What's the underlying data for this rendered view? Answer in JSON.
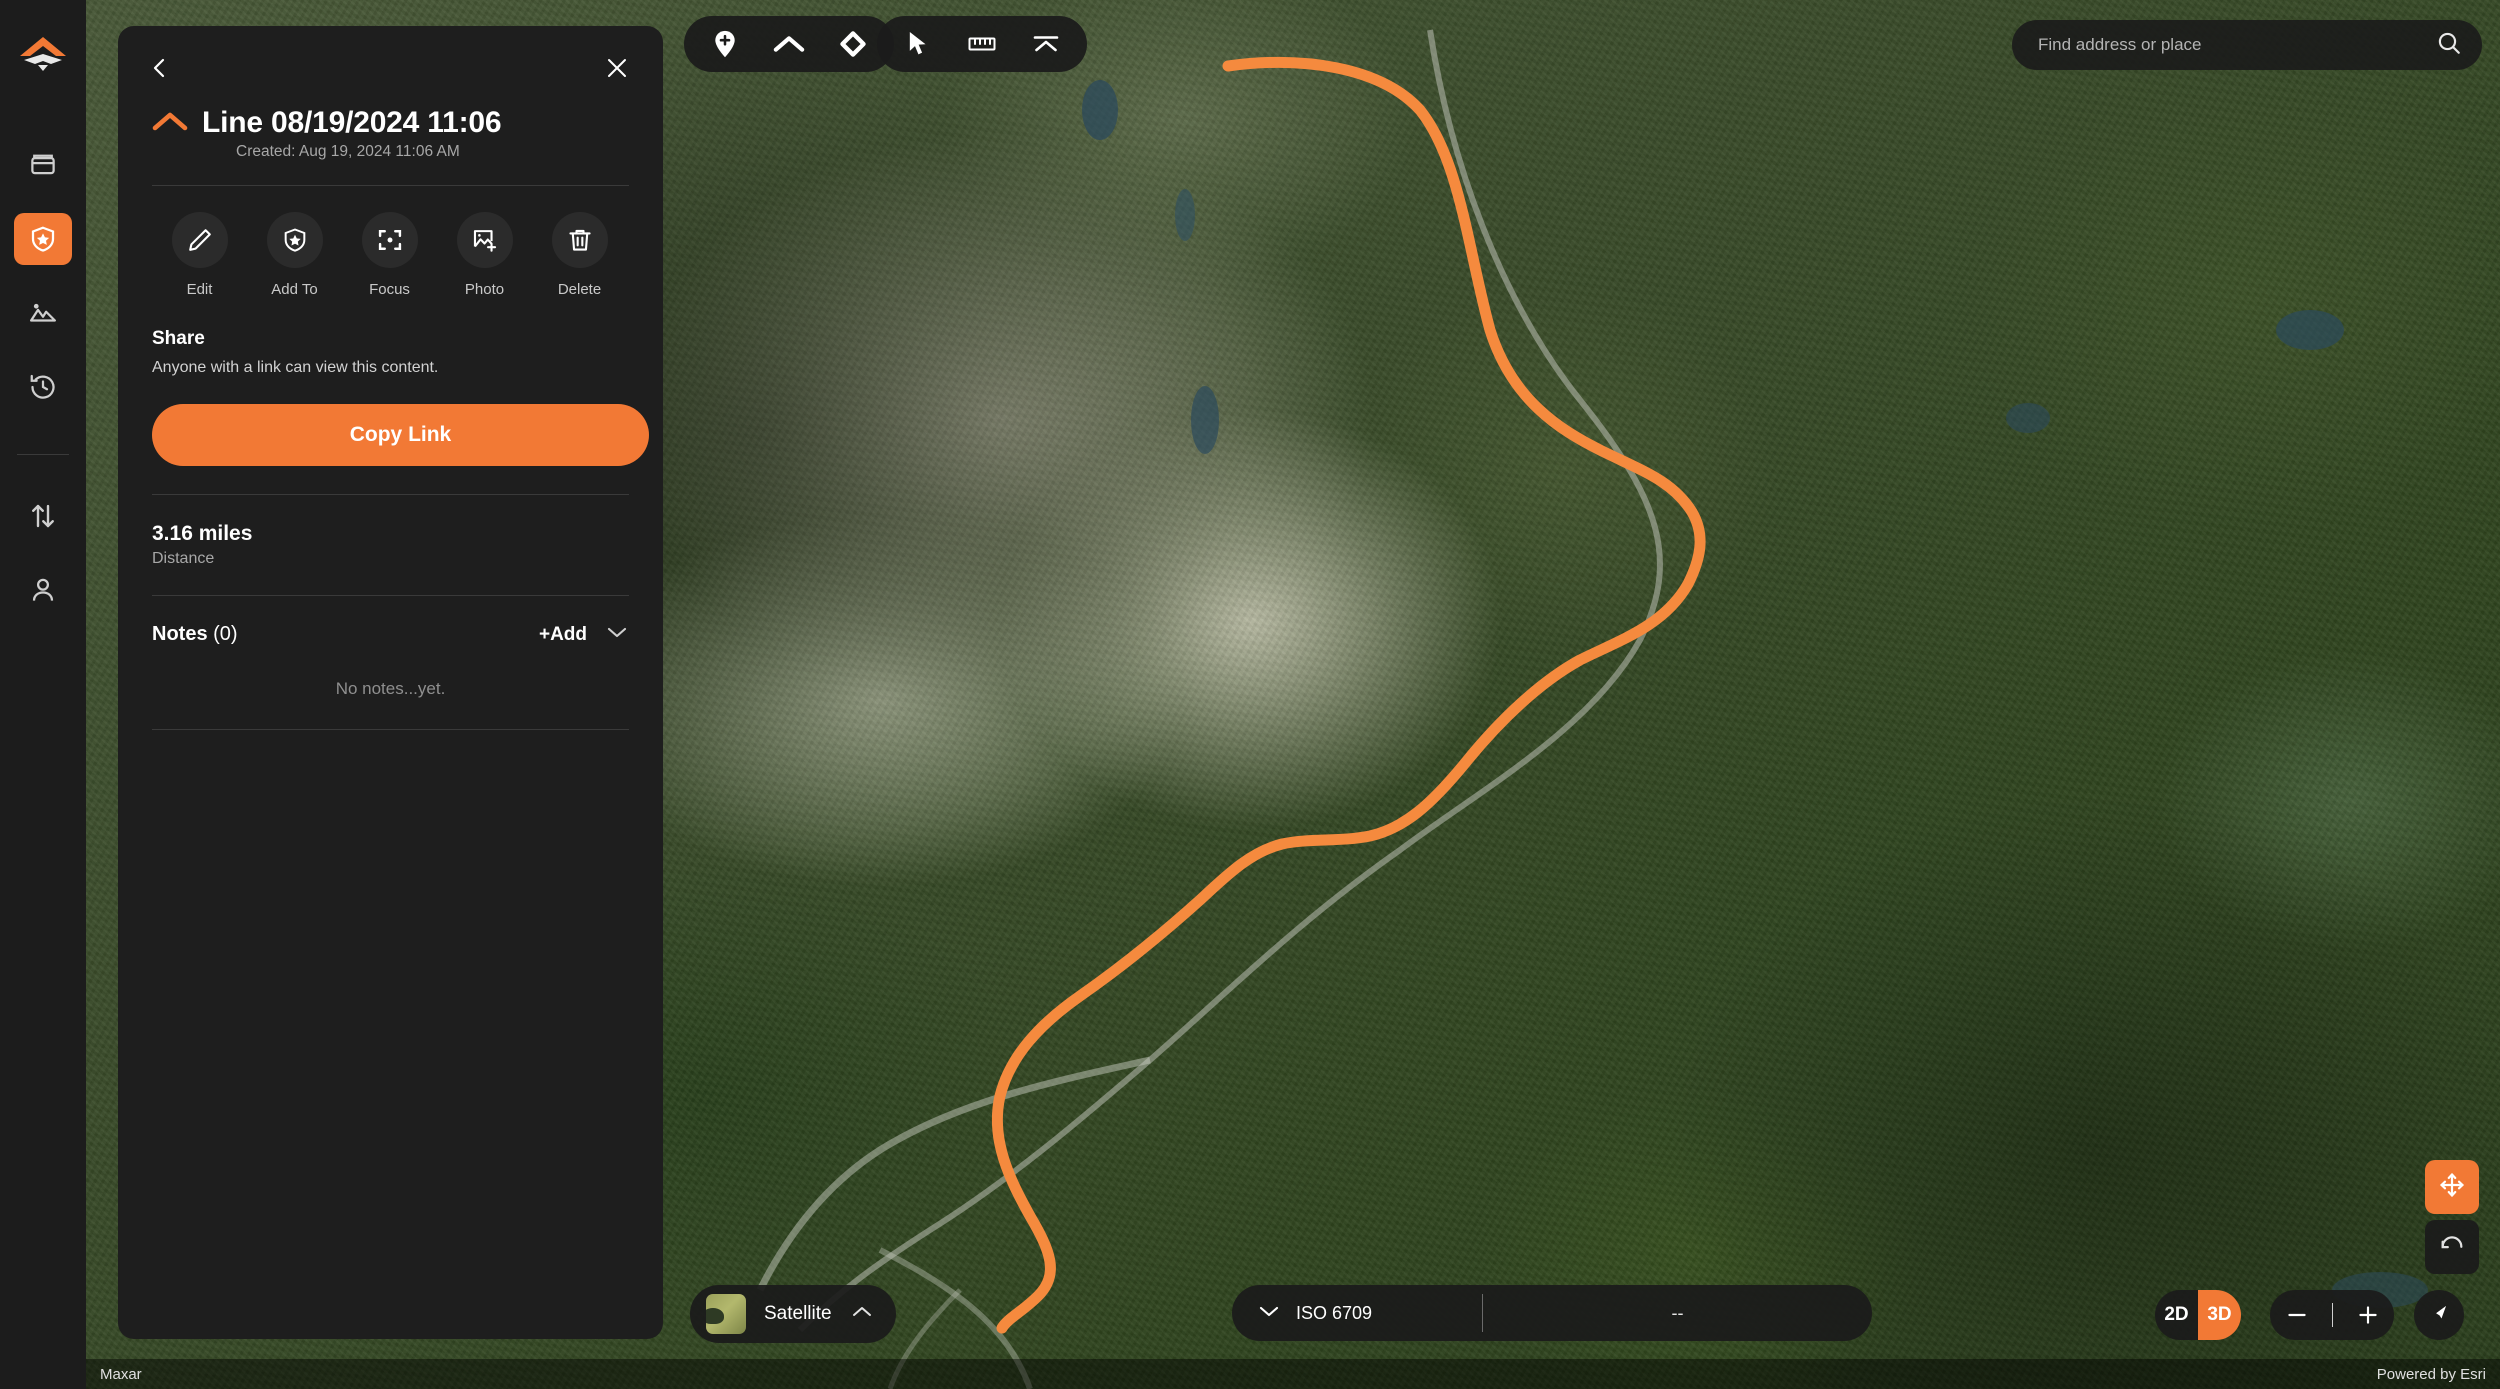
{
  "app": {
    "logo_icon": "mountain-logo-icon",
    "accent_color": "#f27935",
    "panel_bg": "#1e1e1e"
  },
  "rail": {
    "items": [
      {
        "name": "library",
        "icon": "cards-stack-icon",
        "active": false
      },
      {
        "name": "saved",
        "icon": "shield-star-icon",
        "active": true
      },
      {
        "name": "imagery",
        "icon": "mountains-photo-icon",
        "active": false
      },
      {
        "name": "history",
        "icon": "clock-history-icon",
        "active": false
      },
      {
        "name": "transfer",
        "icon": "arrows-up-down-icon",
        "active": false
      },
      {
        "name": "account",
        "icon": "person-icon",
        "active": false
      }
    ]
  },
  "panel": {
    "back_icon": "arrow-left-icon",
    "close_icon": "close-icon",
    "type_icon": "line-chevron-icon",
    "title": "Line 08/19/2024 11:06",
    "created": "Created: Aug 19, 2024 11:06 AM",
    "actions": [
      {
        "label": "Edit",
        "icon": "pencil-icon"
      },
      {
        "label": "Add To",
        "icon": "shield-star-icon"
      },
      {
        "label": "Focus",
        "icon": "focus-frame-icon"
      },
      {
        "label": "Photo",
        "icon": "image-plus-icon"
      },
      {
        "label": "Delete",
        "icon": "trash-icon"
      }
    ],
    "share": {
      "title": "Share",
      "subtitle": "Anyone with a link can view this content.",
      "button_label": "Copy Link"
    },
    "stats": [
      {
        "value": "3.16 miles",
        "caption": "Distance"
      }
    ],
    "notes": {
      "title": "Notes",
      "count": "(0)",
      "add_label": "+Add",
      "chevron_icon": "chevron-down-icon",
      "empty_text": "No notes...yet."
    }
  },
  "map_toolbar": {
    "group_left": [
      {
        "name": "add-point-tool",
        "icon": "pin-plus-icon"
      },
      {
        "name": "add-line-tool",
        "icon": "line-chevron-icon"
      },
      {
        "name": "add-shape-tool",
        "icon": "diamond-outline-icon"
      }
    ],
    "group_right": [
      {
        "name": "select-tool",
        "icon": "cursor-arrow-icon"
      },
      {
        "name": "measure-tool",
        "icon": "ruler-icon"
      },
      {
        "name": "collapse-toolbar",
        "icon": "collapse-up-icon"
      }
    ]
  },
  "search": {
    "placeholder": "Find address or place",
    "value": "",
    "icon": "search-icon"
  },
  "basemap": {
    "label": "Satellite",
    "chevron_icon": "chevron-up-icon",
    "swatch_icon": "satellite-thumbnail-icon"
  },
  "coordinates": {
    "format": "ISO 6709",
    "chevron_icon": "chevron-down-icon",
    "value": "--"
  },
  "view_mode": {
    "options": [
      "2D",
      "3D"
    ],
    "selected": "3D"
  },
  "zoom_control": {
    "minus_label": "−",
    "plus_label": "+"
  },
  "map_controls": {
    "pan_icon": "pan-arrows-icon",
    "rotate_icon": "rotate-icon",
    "compass_icon": "compass-needle-icon"
  },
  "attribution": {
    "left": "Maxar",
    "right": "Powered by Esri"
  }
}
